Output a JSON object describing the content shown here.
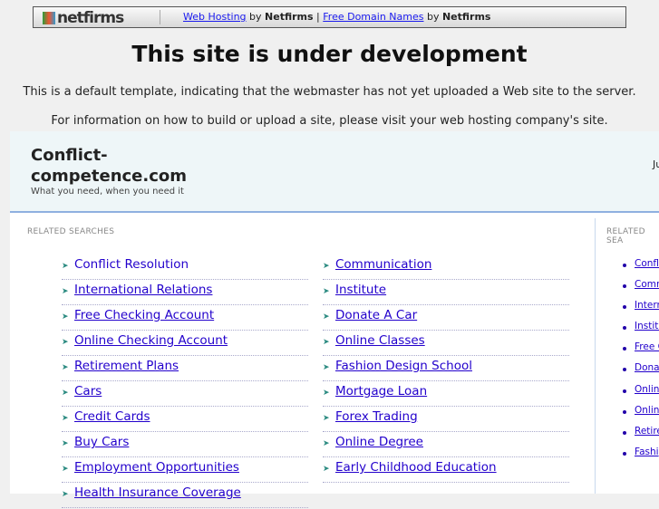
{
  "topbar": {
    "logo": "netfirms",
    "link1": "Web Hosting",
    "by1": " by ",
    "brand1": "Netfirms",
    "pipe": " | ",
    "link2": "Free Domain Names",
    "by2": " by ",
    "brand2": "Netfirms"
  },
  "title": "This site is under development",
  "line1": "This is a default template, indicating that the webmaster has not yet uploaded a Web site to the server.",
  "line2": "For information on how to build or upload a site, please visit your web hosting company's site.",
  "header": {
    "domain_line1": "Conflict-",
    "domain_line2": "competence.com",
    "tagline": "What you need, when you need it",
    "right_fragment": "Ju"
  },
  "related_label": "RELATED SEARCHES",
  "related_label_right": "RELATED SEA",
  "left_col": [
    "Conflict Resolution",
    "International Relations",
    "Free Checking Account",
    "Online Checking Account",
    "Retirement Plans",
    "Cars",
    "Credit Cards",
    "Buy Cars",
    "Employment Opportunities",
    "Health Insurance Coverage"
  ],
  "right_col": [
    "Communication",
    "Institute",
    "Donate A Car",
    "Online Classes",
    "Fashion Design School",
    "Mortgage Loan",
    "Forex Trading",
    "Online Degree",
    "Early Childhood Education"
  ],
  "side_list": [
    "Confl",
    "Comm",
    "Intern",
    "Institu",
    "Free C",
    "Donat",
    "Onlin",
    "Onlin",
    "Retire",
    "Fashi"
  ]
}
